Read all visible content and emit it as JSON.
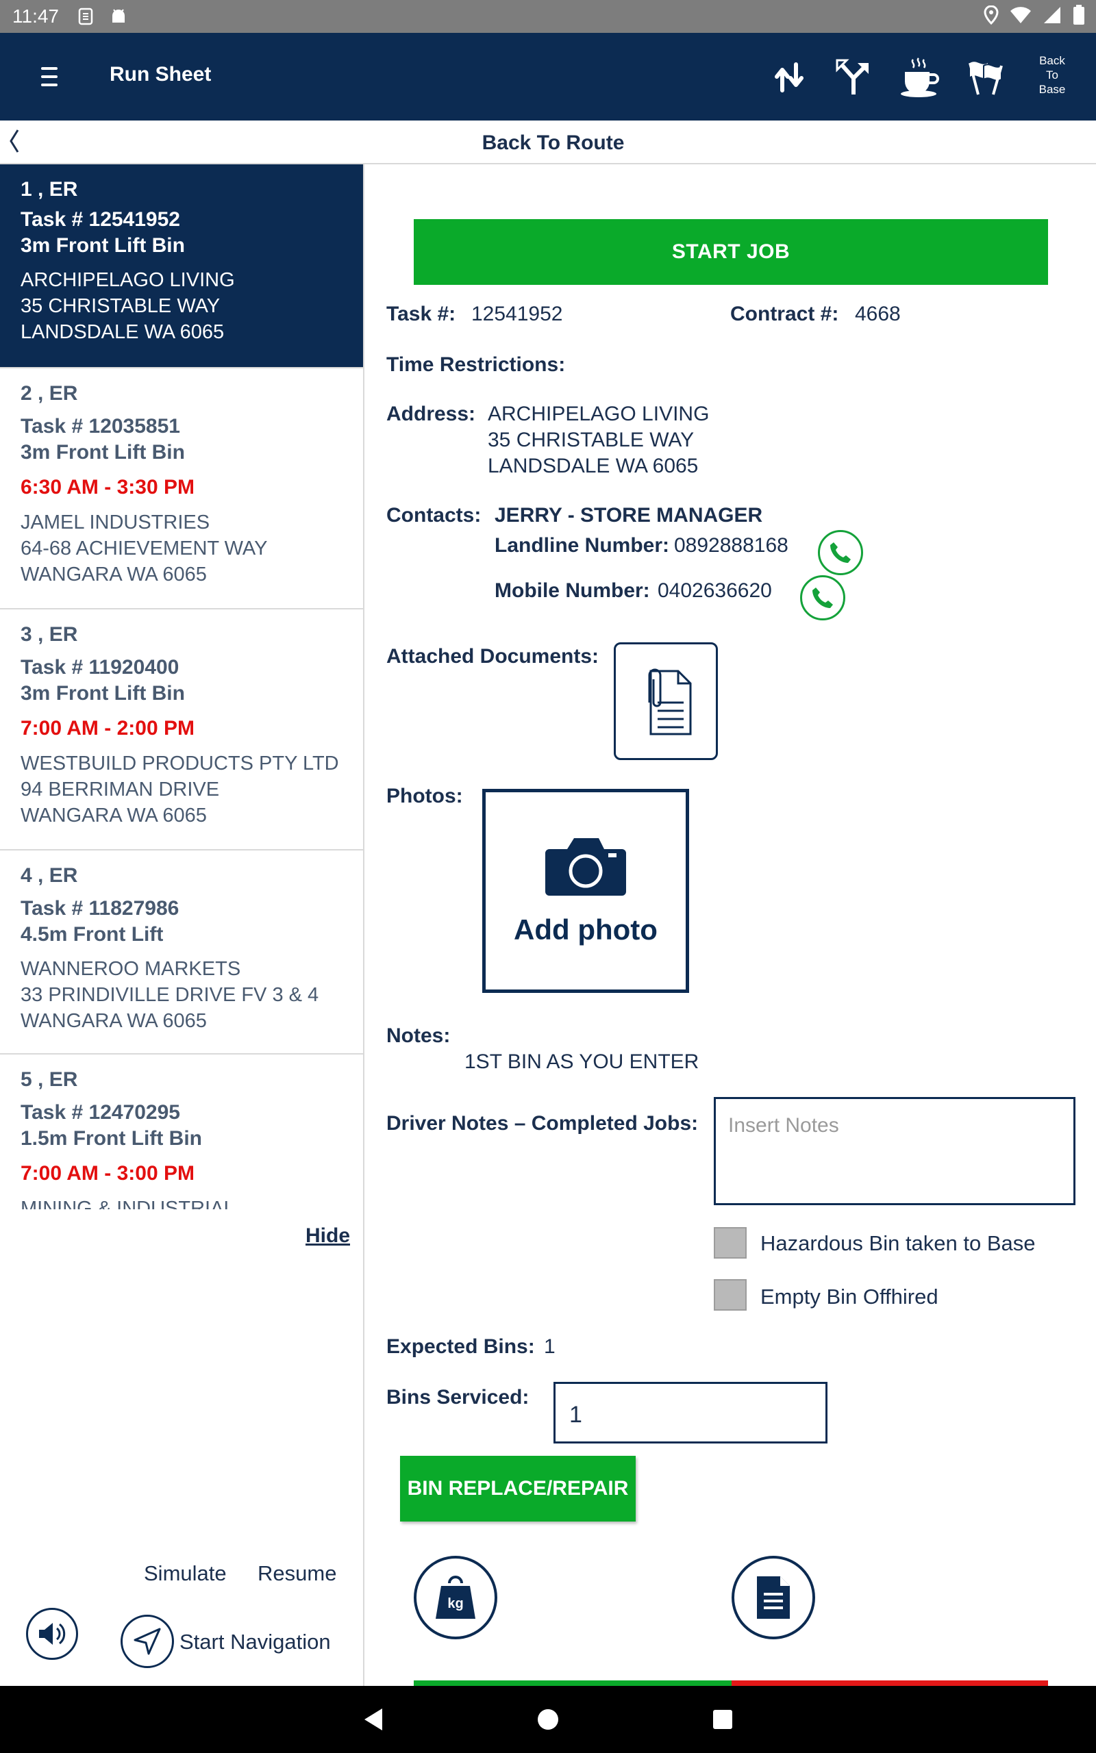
{
  "status_bar": {
    "time": "11:47"
  },
  "app_bar": {
    "title": "Run Sheet",
    "back_to_base": [
      "Back",
      "To",
      "Base"
    ]
  },
  "sub_bar": {
    "label": "Back To Route"
  },
  "tasks": [
    {
      "seq": "1 , ER",
      "task_no": "Task # 12541952",
      "bin": "3m Front Lift Bin",
      "time": "",
      "address": [
        "ARCHIPELAGO LIVING",
        "35 CHRISTABLE WAY",
        "LANDSDALE WA 6065"
      ]
    },
    {
      "seq": "2 , ER",
      "task_no": "Task # 12035851",
      "bin": "3m Front Lift Bin",
      "time": "6:30 AM - 3:30 PM",
      "address": [
        "JAMEL INDUSTRIES",
        "64-68 ACHIEVEMENT WAY",
        "WANGARA WA 6065"
      ]
    },
    {
      "seq": "3 , ER",
      "task_no": "Task # 11920400",
      "bin": "3m Front Lift Bin",
      "time": "7:00 AM - 2:00 PM",
      "address": [
        "WESTBUILD PRODUCTS PTY LTD",
        "94 BERRIMAN DRIVE",
        "WANGARA WA 6065"
      ]
    },
    {
      "seq": "4 , ER",
      "task_no": "Task # 11827986",
      "bin": "4.5m Front Lift",
      "time": "",
      "address": [
        "WANNEROO MARKETS",
        "33 PRINDIVILLE DRIVE FV 3 & 4",
        "WANGARA WA 6065"
      ]
    },
    {
      "seq": "5 , ER",
      "task_no": "Task # 12470295",
      "bin": "1.5m Front Lift Bin",
      "time": "7:00 AM - 3:00 PM",
      "address": [
        "MINING & INDUSTRIAL"
      ]
    }
  ],
  "left_footer": {
    "hide": "Hide",
    "simulate": "Simulate",
    "resume": "Resume",
    "start_navigation": "Start Navigation"
  },
  "detail": {
    "start_job": "START JOB",
    "task_label": "Task #:",
    "task_value": "12541952",
    "contract_label": "Contract #:",
    "contract_value": "4668",
    "time_restrictions_label": "Time Restrictions:",
    "address_label": "Address:",
    "address": [
      "ARCHIPELAGO LIVING",
      "35 CHRISTABLE WAY",
      "LANDSDALE WA 6065"
    ],
    "contacts_label": "Contacts:",
    "contact_name": "JERRY - STORE MANAGER",
    "landline_label": "Landline Number:",
    "landline_value": "0892888168",
    "mobile_label": "Mobile Number:",
    "mobile_value": "0402636620",
    "attached_docs_label": "Attached Documents:",
    "photos_label": "Photos:",
    "add_photo": "Add photo",
    "notes_label": "Notes:",
    "notes_value": "1ST BIN AS YOU ENTER",
    "driver_notes_label": "Driver Notes – Completed Jobs:",
    "driver_notes_placeholder": "Insert Notes",
    "hazardous_label": "Hazardous Bin taken to Base",
    "empty_bin_label": "Empty Bin Offhired",
    "expected_bins_label": "Expected Bins:",
    "expected_bins_value": "1",
    "bins_serviced_label": "Bins Serviced:",
    "bins_serviced_value": "1",
    "bin_replace": "BIN REPLACE/REPAIR",
    "weight_icon_text": "kg"
  },
  "colors": {
    "navy": "#0c2b52",
    "green": "#0aaa2a",
    "red": "#e30f0f"
  }
}
